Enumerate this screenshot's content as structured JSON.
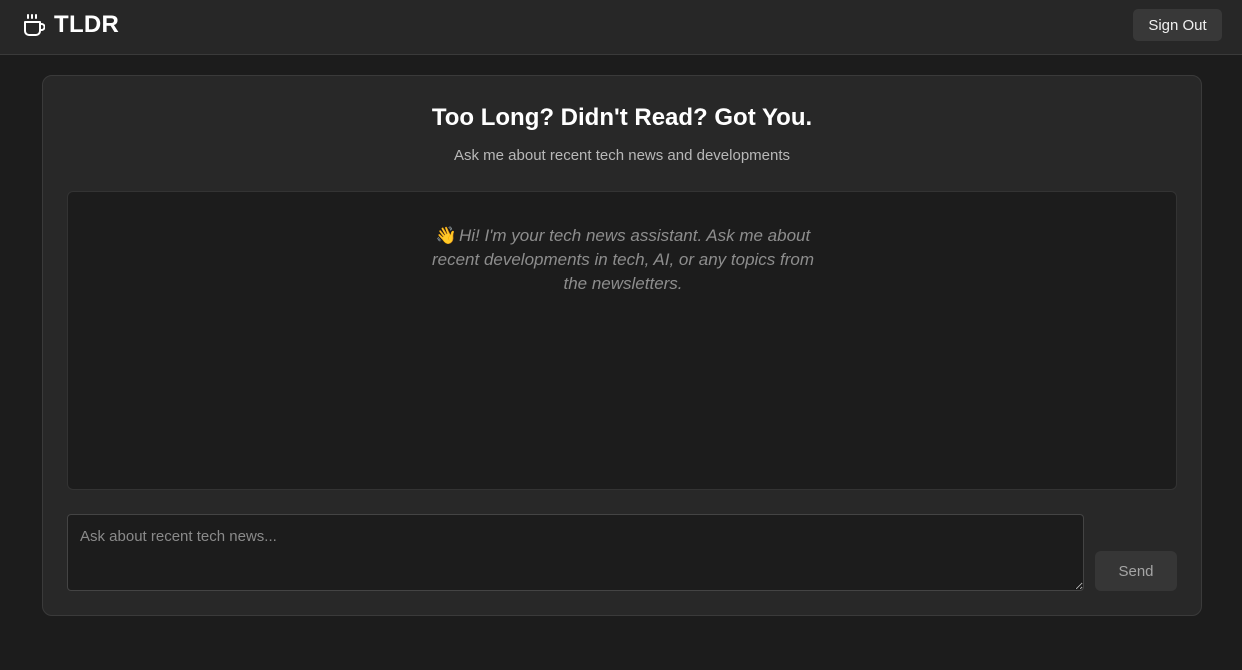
{
  "header": {
    "app_name": "TLDR",
    "logo_icon": "coffee-cup-icon",
    "sign_out_label": "Sign Out"
  },
  "main": {
    "title": "Too Long? Didn't Read? Got You.",
    "subtitle": "Ask me about recent tech news and developments",
    "welcome_emoji": "👋",
    "welcome_message": "Hi! I'm your tech news assistant. Ask me about recent developments in tech, AI, or any topics from the newsletters."
  },
  "composer": {
    "placeholder": "Ask about recent tech news...",
    "value": "",
    "send_label": "Send"
  },
  "colors": {
    "background": "#1c1c1c",
    "header": "#272727",
    "panel": "#282828",
    "button": "#383838",
    "text_primary": "#ffffff",
    "text_muted": "#8d8d8d"
  }
}
